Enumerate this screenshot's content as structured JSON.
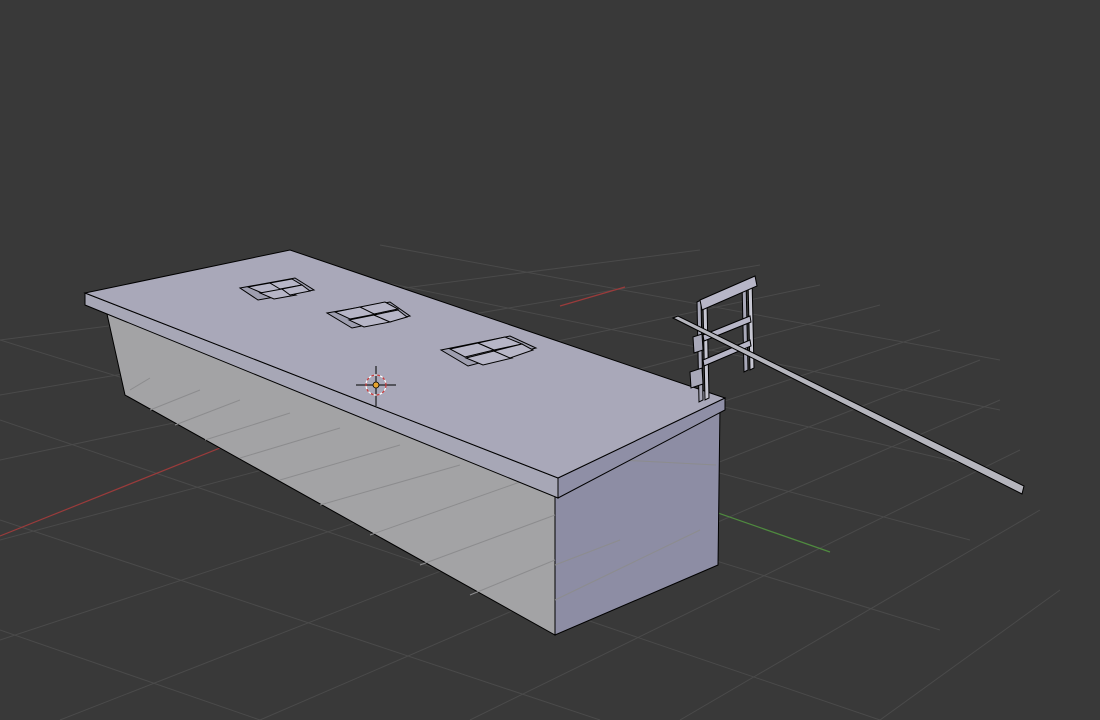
{
  "viewport": {
    "background": "#393939",
    "grid_color": "#4a4a4a",
    "x_axis_color": "#9a3b3b",
    "y_axis_color": "#4f8a3f"
  },
  "scene": {
    "top_face_color": "#a9a8b9",
    "front_face_color": "#a3a3a5",
    "side_face_color": "#8d8da4",
    "edge_color": "#000000",
    "object_names": [
      "building-slab",
      "roof-vents",
      "ladder-railing",
      "pole"
    ]
  },
  "cursor": {
    "icon": "3d-cursor-icon",
    "ring_color": "#d03a3a",
    "center_color": "#e8a431"
  }
}
